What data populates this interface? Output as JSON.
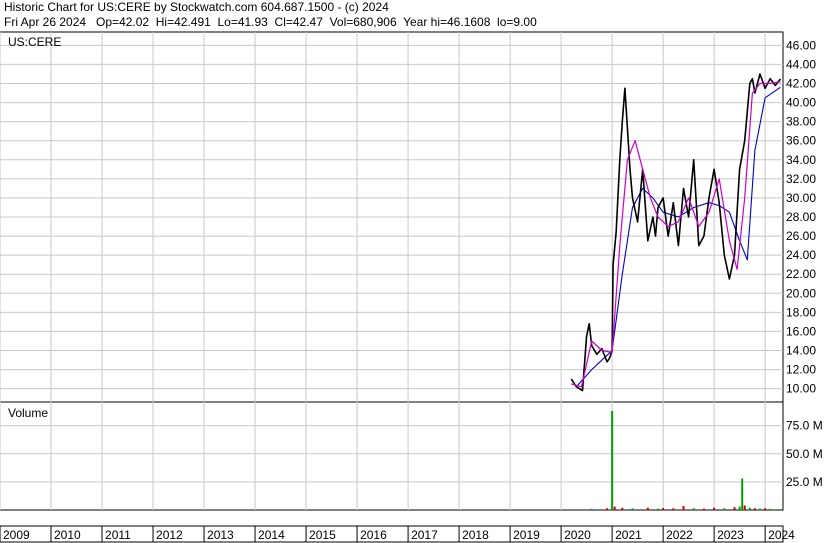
{
  "header": {
    "line1": "Historic Chart for US:CERE by Stockwatch.com 604.687.1500 - (c) 2024",
    "line2": "Fri Apr 26 2024   Op=42.02  Hi=42.491  Lo=41.93  Cl=42.47  Vol=680,906  Year hi=46.1608  lo=9.00"
  },
  "colors": {
    "price": "#000000",
    "ma_short": "#cc00cc",
    "ma_long": "#0000cc",
    "volume_up": "#00a000",
    "volume_down": "#cc0000",
    "grid": "#c8c8c8"
  },
  "chart_data": [
    {
      "type": "line",
      "symbol_label": "US:CERE",
      "ylim": [
        8.6,
        47.4
      ],
      "y_ticks": [
        "10.00",
        "12.00",
        "14.00",
        "16.00",
        "18.00",
        "20.00",
        "22.00",
        "24.00",
        "26.00",
        "28.00",
        "30.00",
        "32.00",
        "34.00",
        "36.00",
        "38.00",
        "40.00",
        "42.00",
        "44.00",
        "46.00"
      ],
      "y_tick_values": [
        10,
        12,
        14,
        16,
        18,
        20,
        22,
        24,
        26,
        28,
        30,
        32,
        34,
        36,
        38,
        40,
        42,
        44,
        46
      ],
      "x_ticks": [
        "2009",
        "2010",
        "2011",
        "2012",
        "2013",
        "2014",
        "2015",
        "2016",
        "2017",
        "2018",
        "2019",
        "2020",
        "2021",
        "2022",
        "2023",
        "2024"
      ],
      "x_tick_values": [
        2009,
        2010,
        2011,
        2012,
        2013,
        2014,
        2015,
        2016,
        2017,
        2018,
        2019,
        2020,
        2021,
        2022,
        2023,
        2024
      ],
      "xlim": [
        2009.0,
        2024.35
      ],
      "series": [
        {
          "role": "price",
          "x": [
            2020.2,
            2020.3,
            2020.42,
            2020.5,
            2020.55,
            2020.6,
            2020.7,
            2020.8,
            2020.9,
            2020.95,
            2021.0,
            2021.02,
            2021.08,
            2021.15,
            2021.2,
            2021.25,
            2021.35,
            2021.4,
            2021.5,
            2021.6,
            2021.7,
            2021.8,
            2021.85,
            2021.9,
            2022.0,
            2022.1,
            2022.2,
            2022.3,
            2022.4,
            2022.5,
            2022.6,
            2022.7,
            2022.8,
            2022.9,
            2023.0,
            2023.1,
            2023.2,
            2023.3,
            2023.4,
            2023.5,
            2023.6,
            2023.7,
            2023.75,
            2023.8,
            2023.9,
            2024.0,
            2024.1,
            2024.2,
            2024.3
          ],
          "y": [
            11.0,
            10.2,
            9.8,
            15.5,
            16.8,
            14.5,
            13.6,
            14.2,
            12.8,
            13.2,
            14.0,
            23.0,
            26.5,
            34.0,
            38.0,
            41.5,
            33.0,
            30.0,
            27.5,
            33.0,
            25.5,
            28.0,
            26.0,
            29.0,
            30.0,
            26.0,
            29.5,
            25.0,
            31.0,
            28.0,
            34.0,
            25.0,
            26.0,
            30.0,
            33.0,
            29.5,
            24.0,
            21.5,
            24.0,
            33.0,
            36.0,
            42.0,
            42.5,
            41.0,
            43.0,
            41.5,
            42.5,
            41.8,
            42.47
          ]
        },
        {
          "role": "ma_short",
          "x": [
            2020.2,
            2020.4,
            2020.6,
            2020.8,
            2021.0,
            2021.15,
            2021.3,
            2021.45,
            2021.6,
            2021.75,
            2021.9,
            2022.1,
            2022.3,
            2022.5,
            2022.7,
            2022.9,
            2023.1,
            2023.3,
            2023.45,
            2023.6,
            2023.75,
            2023.9,
            2024.1,
            2024.3
          ],
          "y": [
            10.5,
            10.2,
            15.0,
            14.0,
            13.8,
            25.0,
            34.0,
            36.0,
            33.0,
            30.0,
            28.0,
            27.0,
            27.5,
            30.0,
            27.0,
            28.5,
            32.0,
            25.5,
            22.5,
            30.0,
            41.0,
            42.0,
            42.0,
            42.2
          ]
        },
        {
          "role": "ma_long",
          "x": [
            2020.3,
            2020.6,
            2020.9,
            2021.0,
            2021.2,
            2021.4,
            2021.6,
            2021.8,
            2022.0,
            2022.3,
            2022.6,
            2022.9,
            2023.1,
            2023.3,
            2023.5,
            2023.65,
            2023.8,
            2024.0,
            2024.3
          ],
          "y": [
            10.2,
            12.0,
            13.5,
            14.0,
            22.0,
            29.0,
            31.0,
            30.0,
            28.5,
            28.0,
            29.0,
            29.5,
            29.2,
            28.5,
            25.5,
            23.5,
            35.0,
            40.5,
            41.6
          ]
        }
      ]
    },
    {
      "type": "bar",
      "label": "Volume",
      "ylim": [
        0,
        96
      ],
      "y_ticks": [
        "25.0 M",
        "50.0 M",
        "75.0 M"
      ],
      "y_tick_values": [
        25,
        50,
        75
      ],
      "x": [
        2020.6,
        2020.9,
        2021.0,
        2021.05,
        2021.2,
        2021.4,
        2021.7,
        2021.9,
        2022.0,
        2022.2,
        2022.4,
        2022.6,
        2022.8,
        2023.0,
        2023.2,
        2023.4,
        2023.5,
        2023.55,
        2023.6,
        2023.7,
        2023.8,
        2023.9,
        2024.0,
        2024.1,
        2024.3
      ],
      "values": [
        1.0,
        1.5,
        88.0,
        3.0,
        2.0,
        1.5,
        2.0,
        1.2,
        1.8,
        1.5,
        3.5,
        1.5,
        1.2,
        2.0,
        1.5,
        2.5,
        3.0,
        28.0,
        4.0,
        2.0,
        1.5,
        1.2,
        1.5,
        1.0,
        0.7
      ],
      "up": [
        true,
        false,
        true,
        false,
        false,
        true,
        false,
        true,
        false,
        false,
        false,
        true,
        false,
        false,
        true,
        false,
        true,
        true,
        false,
        true,
        false,
        true,
        false,
        true,
        true
      ]
    }
  ]
}
